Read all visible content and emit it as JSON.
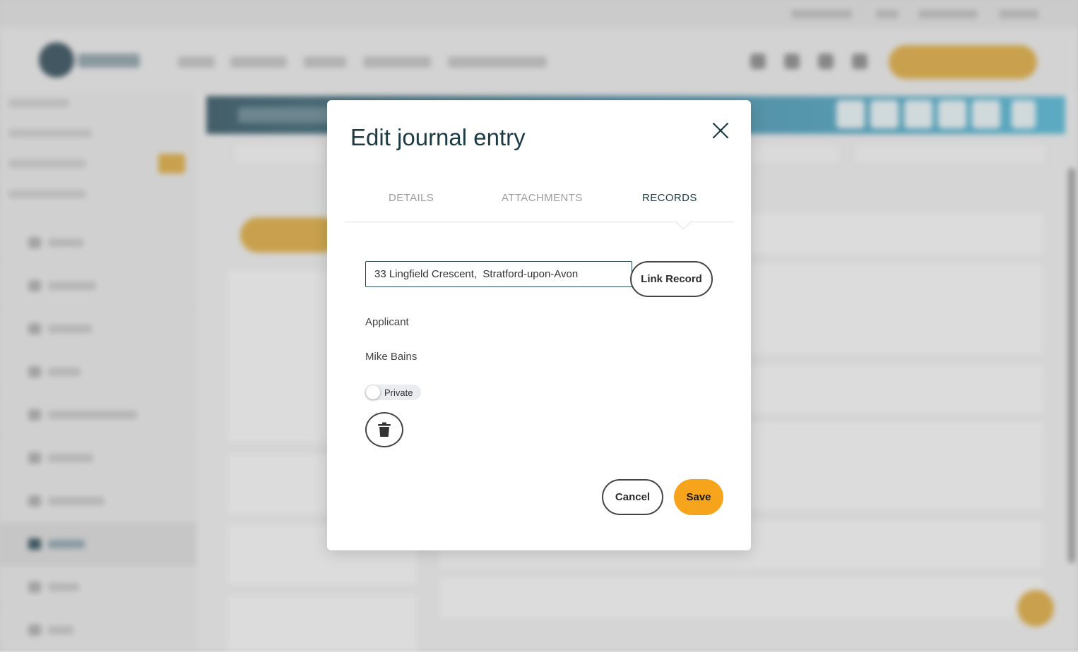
{
  "modal": {
    "title": "Edit journal entry",
    "close_icon": "close-icon",
    "tabs": [
      {
        "label": "DETAILS",
        "active": false
      },
      {
        "label": "ATTACHMENTS",
        "active": false
      },
      {
        "label": "RECORDS",
        "active": true
      }
    ],
    "record_search": {
      "value": "33 Lingfield Crescent,  Stratford-upon-Avon"
    },
    "link_record_label": "Link Record",
    "record": {
      "type": "Applicant",
      "name": "Mike Bains"
    },
    "private_toggle": {
      "label": "Private",
      "on": false
    },
    "delete_icon": "trash-icon",
    "cancel_label": "Cancel",
    "save_label": "Save"
  },
  "colors": {
    "accent": "#f7a41d",
    "title": "#1c3a44",
    "banner_start": "#3f5d68",
    "banner_end": "#5ab4cf"
  }
}
